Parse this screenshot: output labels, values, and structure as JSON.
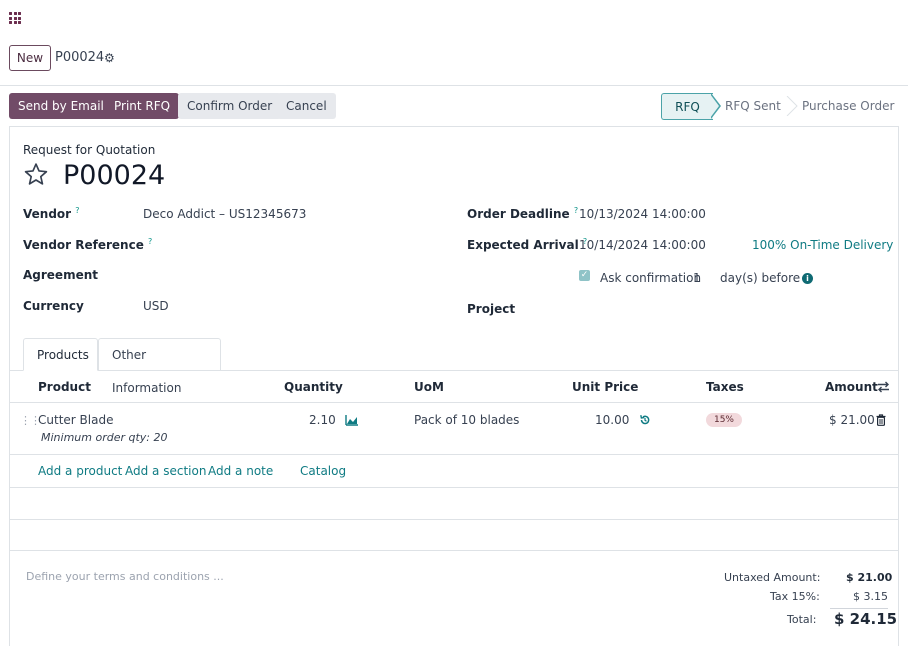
{
  "topbar": {
    "apps_icon": "apps-grid-icon"
  },
  "breadcrumb": {
    "new_label": "New",
    "record": "P00024",
    "gear_icon": "gear-icon"
  },
  "actions": {
    "send_email": "Send by Email",
    "print_rfq": "Print RFQ",
    "confirm_order": "Confirm Order",
    "cancel": "Cancel"
  },
  "status": {
    "steps": [
      "RFQ",
      "RFQ Sent",
      "Purchase Order"
    ],
    "active": "RFQ",
    "accent": "#4ba3a8"
  },
  "form": {
    "doc_type": "Request for Quotation",
    "name": "P00024",
    "vendor_label": "Vendor",
    "vendor_value": "Deco Addict – US12345673",
    "vendor_ref_label": "Vendor Reference",
    "agreement_label": "Agreement",
    "currency_label": "Currency",
    "currency_value": "USD",
    "order_deadline_label": "Order Deadline",
    "order_deadline_value": "10/13/2024 14:00:00",
    "expected_arrival_label": "Expected Arrival",
    "expected_arrival_value": "10/14/2024 14:00:00",
    "on_time": "100% On-Time Delivery",
    "ask_confirm_label": "Ask confirmation",
    "ask_confirm_days": "1",
    "days_before": "day(s) before",
    "project_label": "Project",
    "help_mark": "?"
  },
  "tabs": [
    "Products",
    "Other Information"
  ],
  "table": {
    "headers": {
      "product": "Product",
      "quantity": "Quantity",
      "uom": "UoM",
      "unit_price": "Unit Price",
      "taxes": "Taxes",
      "amount": "Amount"
    },
    "rows": [
      {
        "product": "Cutter Blade",
        "note": "Minimum order qty: 20",
        "quantity": "2.10",
        "uom": "Pack of 10 blades",
        "unit_price": "10.00",
        "tax": "15%",
        "amount": "$ 21.00"
      }
    ],
    "add_links": {
      "product": "Add a product",
      "section": "Add a section",
      "note": "Add a note",
      "catalog": "Catalog"
    }
  },
  "terms_placeholder": "Define your terms and conditions ...",
  "totals": {
    "untaxed_label": "Untaxed Amount:",
    "untaxed_value": "$ 21.00",
    "tax_label": "Tax 15%:",
    "tax_value": "$ 3.15",
    "total_label": "Total:",
    "total_value": "$ 24.15"
  },
  "colors": {
    "primary": "#714b67",
    "link": "#0f7b83"
  }
}
